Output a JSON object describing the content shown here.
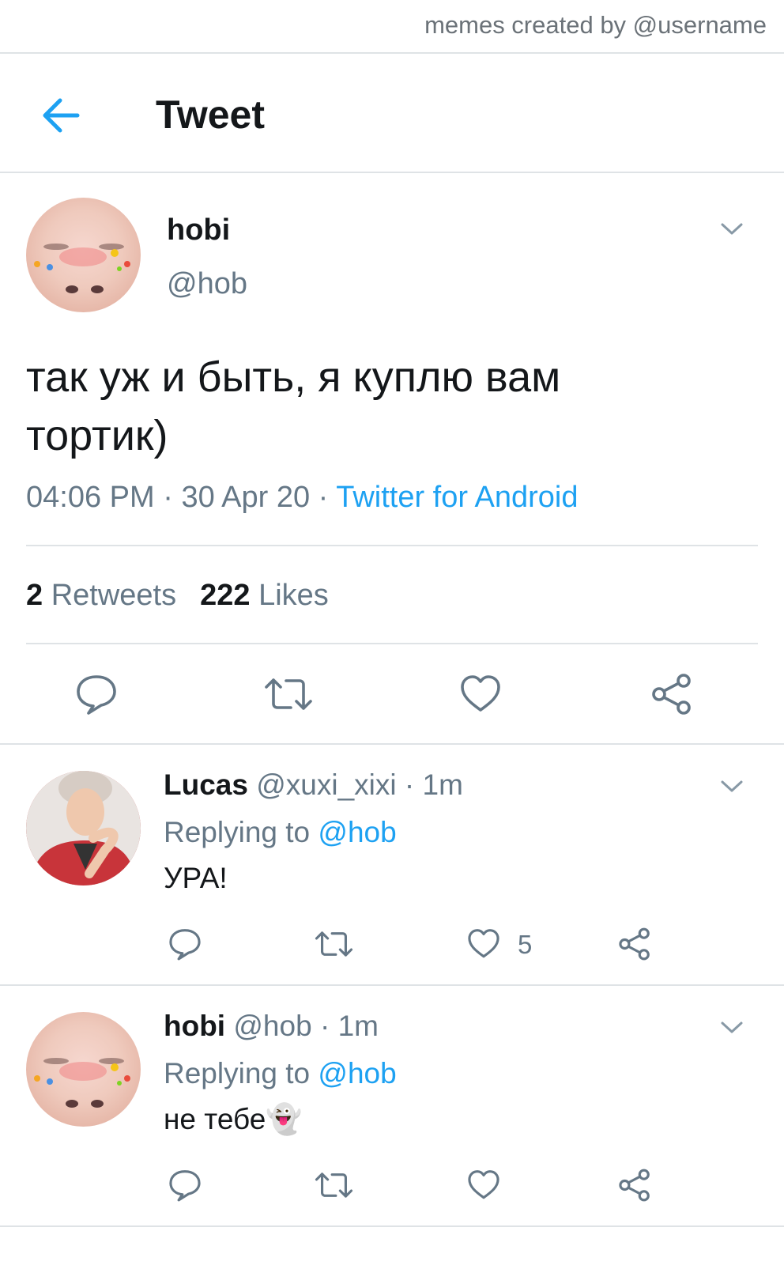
{
  "credit": "memes created by @username",
  "header": {
    "title": "Tweet"
  },
  "tweet": {
    "author_name": "hobi",
    "author_handle": "@hob",
    "text": "так уж и быть, я куплю вам тортик)",
    "time": "04:06 PM",
    "date": "30 Apr 20",
    "source": "Twitter for Android",
    "retweets_count": "2",
    "retweets_label": "Retweets",
    "likes_count": "222",
    "likes_label": "Likes"
  },
  "replies": [
    {
      "name": "Lucas",
      "handle": "@xuxi_xixi",
      "time": "1m",
      "replying_prefix": "Replying to",
      "replying_to": "@hob",
      "text": "УРА!",
      "like_count": "5"
    },
    {
      "name": "hobi",
      "handle": "@hob",
      "time": "1m",
      "replying_prefix": "Replying to",
      "replying_to": "@hob",
      "text": "не тебе👻",
      "like_count": ""
    }
  ],
  "colors": {
    "accent": "#1da1f2",
    "text": "#14171a",
    "secondary": "#657786",
    "divider": "#dfe3e6"
  },
  "icons": [
    "back-arrow-icon",
    "chevron-down-icon",
    "reply-icon",
    "retweet-icon",
    "heart-icon",
    "share-icon"
  ]
}
